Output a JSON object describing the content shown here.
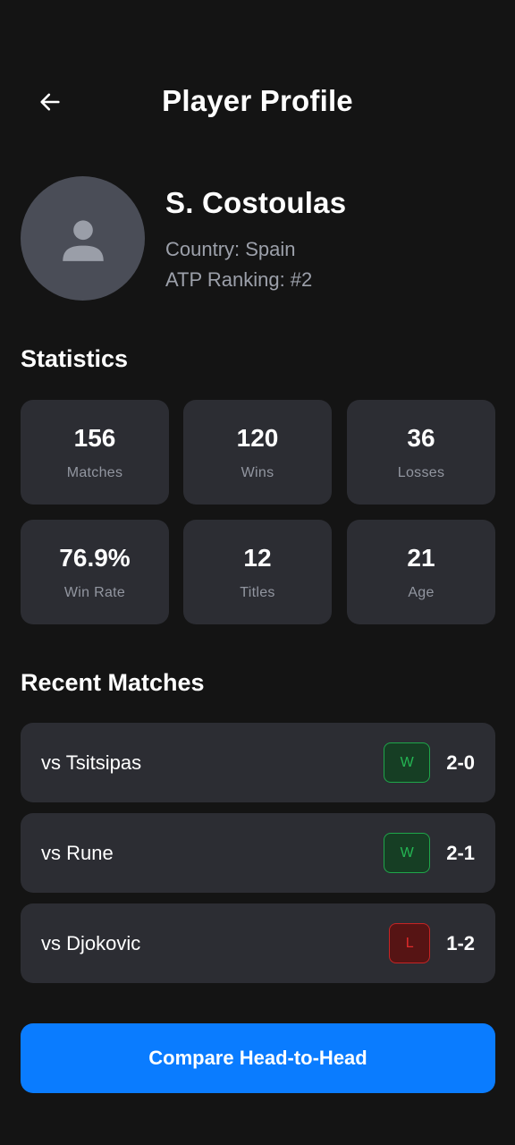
{
  "header": {
    "title": "Player Profile"
  },
  "player": {
    "name": "S. Costoulas",
    "country": "Country: Spain",
    "ranking": "ATP Ranking: #2"
  },
  "statistics": {
    "title": "Statistics",
    "cards": [
      {
        "value": "156",
        "label": "Matches"
      },
      {
        "value": "120",
        "label": "Wins"
      },
      {
        "value": "36",
        "label": "Losses"
      },
      {
        "value": "76.9%",
        "label": "Win Rate"
      },
      {
        "value": "12",
        "label": "Titles"
      },
      {
        "value": "21",
        "label": "Age"
      }
    ]
  },
  "recent_matches": {
    "title": "Recent Matches",
    "items": [
      {
        "opponent": "vs Tsitsipas",
        "result": "W",
        "score": "2-0"
      },
      {
        "opponent": "vs Rune",
        "result": "W",
        "score": "2-1"
      },
      {
        "opponent": "vs Djokovic",
        "result": "L",
        "score": "1-2"
      }
    ]
  },
  "cta": {
    "label": "Compare Head-to-Head"
  },
  "icons": {
    "back": "arrow-left-icon",
    "avatar": "user-icon"
  },
  "colors": {
    "background": "#141414",
    "card": "#2c2d33",
    "accent": "#0a7cff",
    "win": "#24b653",
    "loss": "#e02b2b"
  }
}
